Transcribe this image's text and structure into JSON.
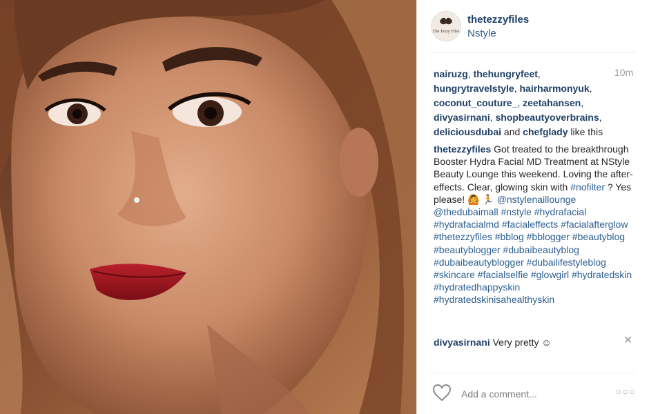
{
  "post": {
    "image_alt_subject": "selfie",
    "author": "thetezzyfiles",
    "location": "Nstyle",
    "avatar_text": "The Tezzy Files",
    "time": "10m"
  },
  "likes": {
    "users": [
      "nairuzg",
      "thehungryfeet",
      "hungrytravelstyle",
      "hairharmonyuk",
      "coconut_couture_",
      "zeetahansen",
      "divyasirnani",
      "shopbeautyoverbrains",
      "deliciousdubai",
      "chefglady"
    ],
    "and_text": "and",
    "suffix": "like this"
  },
  "caption": {
    "user": "thetezzyfiles",
    "text_1": "Got treated to the breakthrough Booster Hydra Facial MD Treatment at NStyle Beauty Lounge this weekend. Loving the after-effects. Clear, glowing skin with",
    "tag_nofilter": "#nofilter",
    "text_2": "? Yes please! 🙆",
    "emoji_2": "🏃",
    "mentions": "@nstylenaillounge @thedubaimall",
    "hashtags": "#nstyle #hydrafacial #hydrafacialmd #facialeffects #facialafterglow #thetezzyfiles #bblog #bblogger #beautyblog #beautyblogger #dubaibeautyblog #dubaibeautyblogger #dubailifestyleblog #skincare #facialselfie #glowgirl #hydratedskin #hydratedhappyskin #hydratedskinisahealthyskin"
  },
  "comment": {
    "user": "divyasirnani",
    "text": "Very pretty ☺"
  },
  "add_comment": {
    "placeholder": "Add a comment..."
  },
  "icons": {
    "like": "heart-icon",
    "more": "more-options-icon",
    "close": "close-icon"
  },
  "colors": {
    "link": "#1e3f66",
    "hashtag": "#2d5f91",
    "muted": "#9b9b9b"
  }
}
